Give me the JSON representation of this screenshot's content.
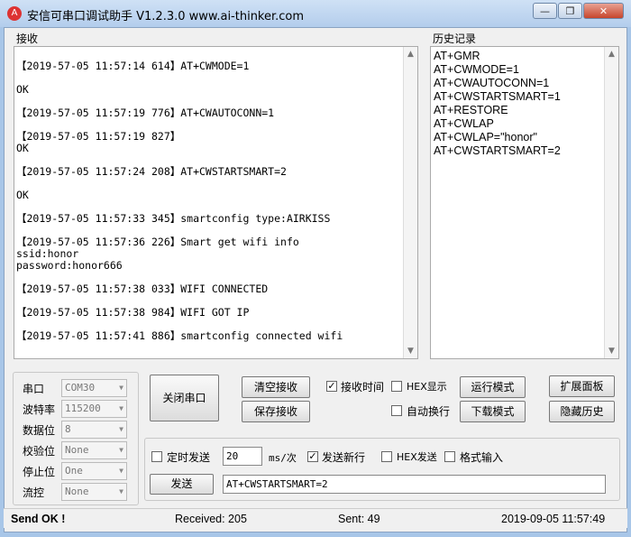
{
  "window": {
    "title": "安信可串口调试助手 V1.2.3.0    www.ai-thinker.com",
    "icon": "ai-thinker-logo-icon",
    "minimize_glyph": "—",
    "restore_glyph": "❐",
    "close_glyph": "✕"
  },
  "receive": {
    "label": "接收",
    "lines": [
      "",
      "【2019-57-05 11:57:14 614】AT+CWMODE=1",
      "",
      "OK",
      "",
      "【2019-57-05 11:57:19 776】AT+CWAUTOCONN=1",
      "",
      "【2019-57-05 11:57:19 827】",
      "OK",
      "",
      "【2019-57-05 11:57:24 208】AT+CWSTARTSMART=2",
      "",
      "OK",
      "",
      "【2019-57-05 11:57:33 345】smartconfig type:AIRKISS",
      "",
      "【2019-57-05 11:57:36 226】Smart get wifi info",
      "ssid:honor",
      "password:honor666",
      "",
      "【2019-57-05 11:57:38 033】WIFI CONNECTED",
      "",
      "【2019-57-05 11:57:38 984】WIFI GOT IP",
      "",
      "【2019-57-05 11:57:41 886】smartconfig connected wifi"
    ]
  },
  "history": {
    "label": "历史记录",
    "items": [
      "AT+GMR",
      "AT+CWMODE=1",
      "AT+CWAUTOCONN=1",
      "AT+CWSTARTSMART=1",
      "AT+RESTORE",
      "AT+CWLAP",
      "AT+CWLAP=\"honor\"",
      "AT+CWSTARTSMART=2"
    ]
  },
  "serial": {
    "port_label": "串口",
    "port_value": "COM30",
    "baud_label": "波特率",
    "baud_value": "115200",
    "databits_label": "数据位",
    "databits_value": "8",
    "parity_label": "校验位",
    "parity_value": "None",
    "stopbits_label": "停止位",
    "stopbits_value": "One",
    "flow_label": "流控",
    "flow_value": "None"
  },
  "controls": {
    "close_port": "关闭串口",
    "clear_recv": "清空接收",
    "save_recv": "保存接收",
    "recv_time": "接收时间",
    "recv_time_checked": true,
    "hex_display": "HEX显示",
    "hex_display_checked": false,
    "auto_newline": "自动换行",
    "auto_newline_checked": false,
    "run_mode": "运行模式",
    "download_mode": "下载模式",
    "expand_panel": "扩展面板",
    "hide_history": "隐藏历史"
  },
  "send": {
    "timed_send": "定时发送",
    "timed_send_checked": false,
    "interval_value": "20",
    "interval_unit": "ms/次",
    "send_newline": "发送新行",
    "send_newline_checked": true,
    "hex_send": "HEX发送",
    "hex_send_checked": false,
    "format_input": "格式输入",
    "format_input_checked": false,
    "send_button": "发送",
    "input_value": "AT+CWSTARTSMART=2"
  },
  "status": {
    "message": "Send OK !",
    "received": "Received: 205",
    "sent": "Sent: 49",
    "datetime": "2019-09-05 11:57:49"
  }
}
